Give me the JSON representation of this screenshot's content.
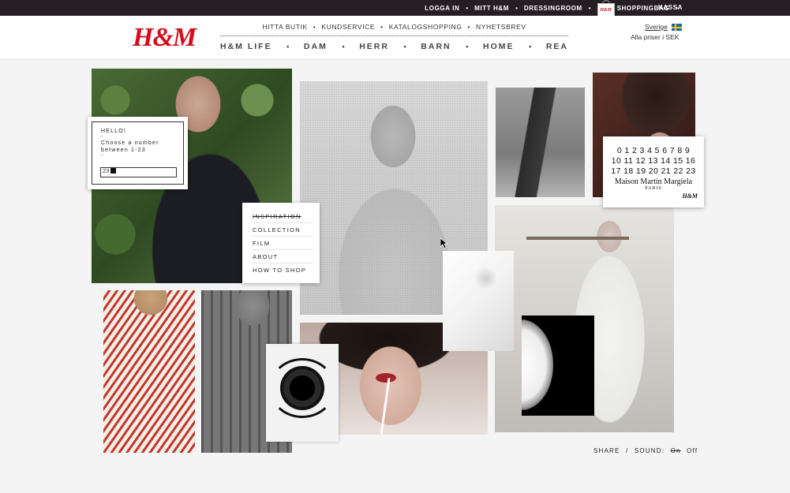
{
  "topbar": {
    "links": [
      "LOGGA IN",
      "MITT H&M",
      "DRESSINGROOM",
      "SHOPPINGBAG",
      "KASSA"
    ],
    "bag_logo": "H&M"
  },
  "header": {
    "logo": "H&M",
    "subnav": [
      "HITTA BUTIK",
      "KUNDSERVICE",
      "KATALOGSHOPPING",
      "NYHETSBREV"
    ],
    "mainnav": [
      "H&M LIFE",
      "DAM",
      "HERR",
      "BARN",
      "HOME",
      "REA"
    ],
    "region": "Sverige",
    "prices": "Alla priser i SEK"
  },
  "hello_popup": {
    "title": "HELLO!",
    "prompt_line1": "Choose a number",
    "prompt_line2": "between 1-23",
    "input_value": "23"
  },
  "side_menu": {
    "items": [
      "INSPIRATION",
      "COLLECTION",
      "FILM",
      "ABOUT",
      "HOW TO SHOP"
    ],
    "active": "INSPIRATION"
  },
  "margiela_card": {
    "rows": [
      "0 1 2 3 4 5 6 7 8 9",
      "10 11 12 13 14 15 16",
      "17 18 19 20 21 22 23"
    ],
    "brand": "Maison Martin Margiela",
    "city": "PARIS",
    "mini_logo": "H&M"
  },
  "footer": {
    "share": "SHARE",
    "slash": "/",
    "sound_label": "SOUND:",
    "sound_on": "On",
    "sound_off": "Off"
  }
}
